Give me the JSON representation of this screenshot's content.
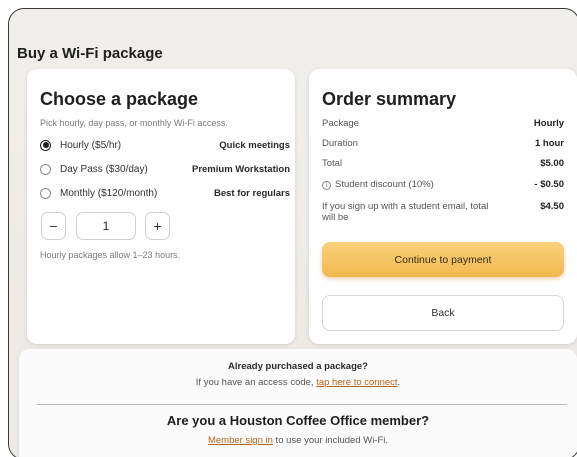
{
  "page": {
    "title": "Buy a Wi-Fi package"
  },
  "package_card": {
    "heading": "Choose a package",
    "subtitle": "Pick hourly, day pass, or monthly Wi-Fi access.",
    "options": [
      {
        "label": "Hourly ($5/hr)",
        "tag": "Quick meetings",
        "selected": true
      },
      {
        "label": "Day Pass ($30/day)",
        "tag": "Premium Workstation",
        "selected": false
      },
      {
        "label": "Monthly ($120/month)",
        "tag": "Best for regulars",
        "selected": false
      }
    ],
    "stepper": {
      "minus": "−",
      "value": "1",
      "plus": "+"
    },
    "hint": "Hourly packages allow 1–23 hours."
  },
  "order_summary": {
    "heading": "Order summary",
    "rows": [
      {
        "label": "Package",
        "value": "Hourly"
      },
      {
        "label": "Duration",
        "value": "1 hour"
      },
      {
        "label": "Total",
        "value": "$5.00"
      },
      {
        "label": "Student discount (10%)",
        "value": "- $0.50"
      },
      {
        "label": "If you sign up with a student email, total will be",
        "value": "$4.50"
      }
    ],
    "continue_label": "Continue to payment",
    "back_label": "Back"
  },
  "bottom": {
    "already_title": "Already purchased a package?",
    "already_text": "If you have an access code, ",
    "already_link": "tap here to connect",
    "already_end": ".",
    "member_title": "Are you a Houston Coffee Office member?",
    "member_link": "Member sign in",
    "member_text": " to use your included Wi-Fi."
  },
  "colors": {
    "accent": "#f2b84e",
    "link": "#b5651d"
  },
  "icons": {
    "info": "info-icon"
  }
}
